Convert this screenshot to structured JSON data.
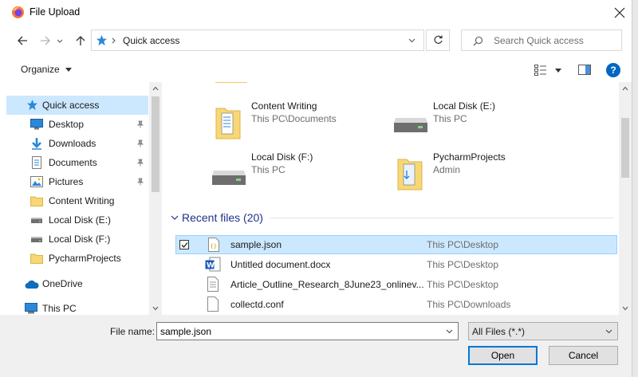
{
  "window": {
    "title": "File Upload"
  },
  "address": {
    "location": "Quick access"
  },
  "search": {
    "placeholder": "Search Quick access"
  },
  "toolbar": {
    "organize_label": "Organize"
  },
  "sidebar": {
    "items": [
      {
        "label": "Quick access",
        "icon": "star-icon",
        "pinned": false
      },
      {
        "label": "Desktop",
        "icon": "desktop-icon",
        "pinned": true
      },
      {
        "label": "Downloads",
        "icon": "download-arrow-icon",
        "pinned": true
      },
      {
        "label": "Documents",
        "icon": "document-icon",
        "pinned": true
      },
      {
        "label": "Pictures",
        "icon": "picture-icon",
        "pinned": true
      },
      {
        "label": "Content Writing",
        "icon": "folder-icon",
        "pinned": false
      },
      {
        "label": "Local Disk (E:)",
        "icon": "drive-icon",
        "pinned": false
      },
      {
        "label": "Local Disk (F:)",
        "icon": "drive-icon",
        "pinned": false
      },
      {
        "label": "PycharmProjects",
        "icon": "folder-icon",
        "pinned": false
      },
      {
        "label": "OneDrive",
        "icon": "cloud-icon",
        "pinned": false
      },
      {
        "label": "This PC",
        "icon": "computer-icon",
        "pinned": false
      }
    ]
  },
  "tiles": [
    {
      "name": "Content Writing",
      "sub": "This PC\\Documents",
      "icon": "folder-icon"
    },
    {
      "name": "Local Disk (E:)",
      "sub": "This PC",
      "icon": "drive-icon"
    },
    {
      "name": "Local Disk (F:)",
      "sub": "This PC",
      "icon": "drive-icon"
    },
    {
      "name": "PycharmProjects",
      "sub": "Admin",
      "icon": "folder-icon"
    }
  ],
  "recent": {
    "header": "Recent files (20)",
    "files": [
      {
        "name": "sample.json",
        "location": "This PC\\Desktop",
        "icon": "json-file-icon",
        "selected": true
      },
      {
        "name": "Untitled document.docx",
        "location": "This PC\\Desktop",
        "icon": "word-file-icon",
        "selected": false
      },
      {
        "name": "Article_Outline_Research_8June23_onlinev...",
        "location": "This PC\\Desktop",
        "icon": "text-file-icon",
        "selected": false
      },
      {
        "name": "collectd.conf",
        "location": "This PC\\Downloads",
        "icon": "blank-file-icon",
        "selected": false
      }
    ]
  },
  "bottom": {
    "filename_label": "File name:",
    "filename_value": "sample.json",
    "filetype_value": "All Files (*.*)",
    "open_label": "Open",
    "cancel_label": "Cancel"
  },
  "colors": {
    "accent": "#0067c0",
    "selection": "#cce8ff",
    "selection_border": "#99d1ff",
    "folder": "#f8d775"
  }
}
